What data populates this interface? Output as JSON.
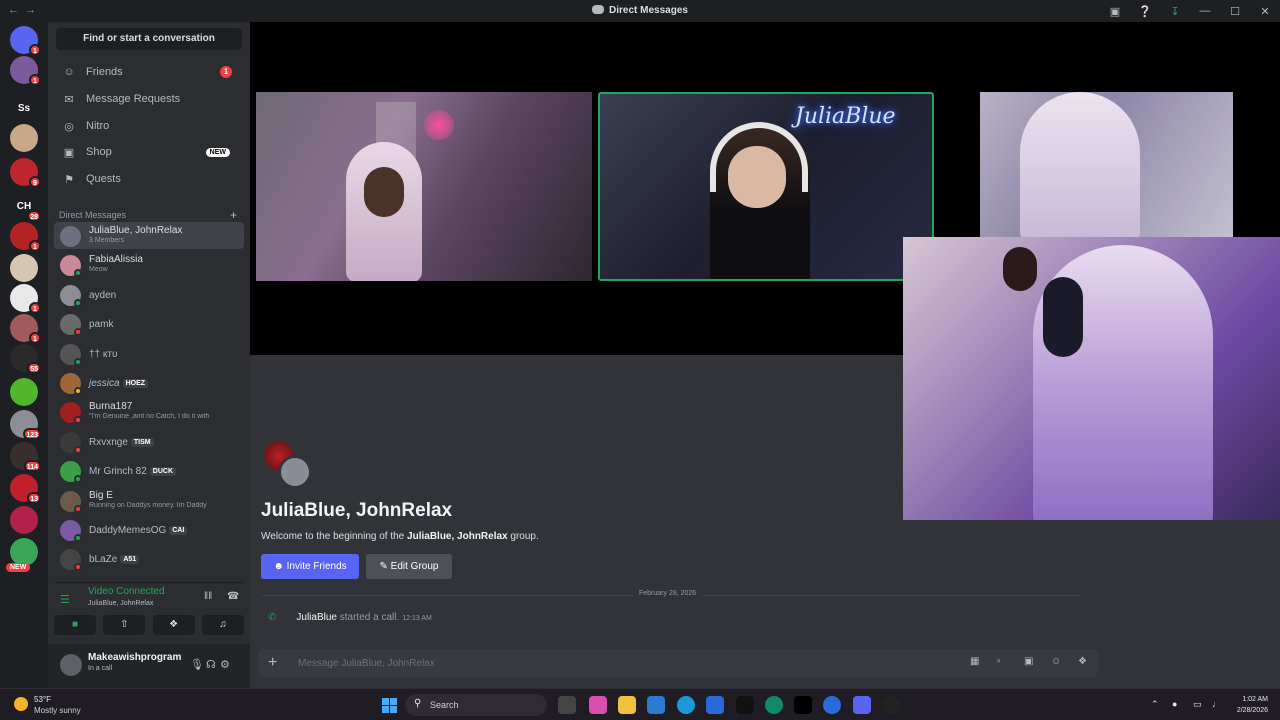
{
  "titlebar": {
    "title": "Direct Messages",
    "back": "←",
    "forward": "→"
  },
  "rail": {
    "servers": [
      {
        "label": "",
        "color": "#5865f2",
        "badge": "1",
        "icon": "discord-logo-icon"
      },
      {
        "label": "",
        "color": "#7a5a9a",
        "badge": "1",
        "icon": "server-avatar-icon"
      },
      {
        "label": "Ss",
        "color": "#1e1f22",
        "badge": "",
        "icon": ""
      },
      {
        "label": "",
        "color": "#c9a88a",
        "badge": "",
        "icon": "server-avatar-icon"
      },
      {
        "label": "",
        "color": "#c0262d",
        "badge": "9",
        "icon": "server-avatar-icon"
      },
      {
        "label": "CH",
        "color": "#1e1f22",
        "badge": "28",
        "icon": ""
      },
      {
        "label": "",
        "color": "#b22323",
        "badge": "1",
        "icon": "server-avatar-icon"
      },
      {
        "label": "",
        "color": "#d4c6b0",
        "badge": "",
        "icon": "server-avatar-icon"
      },
      {
        "label": "",
        "color": "#e8e8e8",
        "badge": "1",
        "icon": "server-avatar-icon"
      },
      {
        "label": "",
        "color": "#a05a5a",
        "badge": "1",
        "icon": "server-avatar-icon"
      },
      {
        "label": "",
        "color": "#2a2a2a",
        "badge": "55",
        "icon": "server-avatar-icon"
      },
      {
        "label": "",
        "color": "#4fb52a",
        "badge": "",
        "icon": "server-avatar-icon"
      },
      {
        "label": "",
        "color": "#8d8d95",
        "badge": "123",
        "icon": "server-avatar-icon"
      },
      {
        "label": "",
        "color": "#3a2f2f",
        "badge": "114",
        "icon": "server-avatar-icon"
      },
      {
        "label": "",
        "color": "#c0202a",
        "badge": "13",
        "icon": "server-avatar-icon"
      },
      {
        "label": "",
        "color": "#b3204a",
        "badge": "",
        "icon": "server-avatar-icon"
      },
      {
        "label": "",
        "color": "#3ba55a",
        "badge": "",
        "icon": "server-avatar-icon",
        "new": "NEW"
      }
    ]
  },
  "sidebar": {
    "find_label": "Find or start a conversation",
    "nav": [
      {
        "label": "Friends",
        "icon": "friends-icon",
        "glyph": "☺",
        "count": "1"
      },
      {
        "label": "Message Requests",
        "icon": "envelope-icon",
        "glyph": "✉",
        "count": ""
      },
      {
        "label": "Nitro",
        "icon": "nitro-icon",
        "glyph": "◎",
        "count": ""
      },
      {
        "label": "Shop",
        "icon": "shop-icon",
        "glyph": "▣",
        "count": "",
        "pill": "NEW"
      },
      {
        "label": "Quests",
        "icon": "quests-icon",
        "glyph": "⚑",
        "count": ""
      }
    ],
    "dm_header": "Direct Messages",
    "dms": [
      {
        "name": "JuliaBlue, JohnRelax",
        "sub": "3 Members",
        "tag": "",
        "status": "",
        "color": "#6e7080",
        "active": true
      },
      {
        "name": "FabiaAlissia",
        "sub": "Meow",
        "tag": "",
        "status": "#23a55a",
        "color": "#c88a9a"
      },
      {
        "name": "ayden",
        "sub": "",
        "tag": "",
        "status": "#23a55a",
        "color": "#8d8d95"
      },
      {
        "name": "pamk",
        "sub": "",
        "tag": "",
        "status": "#f23f43",
        "color": "#6a6a6a"
      },
      {
        "name": "†† ктυ",
        "sub": "",
        "tag": "",
        "status": "#23a55a",
        "color": "#555"
      },
      {
        "name": "jessica",
        "sub": "",
        "tag": "HOEZ",
        "status": "#f0b232",
        "color": "#a0663a",
        "italic": true
      },
      {
        "name": "Burna187",
        "sub": "\"I'm Genuine ,aint no Catch, I do it with",
        "tag": "",
        "status": "#f23f43",
        "color": "#a02020"
      },
      {
        "name": "Rxvxnge",
        "sub": "",
        "tag": "TISM",
        "status": "#f23f43",
        "color": "#3a3a3a"
      },
      {
        "name": "Mr Grinch 82",
        "sub": "",
        "tag": "DUCK",
        "status": "#23a55a",
        "color": "#3aa04a"
      },
      {
        "name": "Big E",
        "sub": "Running on Daddys money. Im Daddy",
        "tag": "",
        "status": "#f23f43",
        "color": "#6e5a4a"
      },
      {
        "name": "DaddyMemesOG",
        "sub": "",
        "tag": "CAI",
        "status": "#23a55a",
        "color": "#7a5aa0"
      },
      {
        "name": "bLaZe",
        "sub": "",
        "tag": "A51",
        "status": "#f23f43",
        "color": "#444"
      }
    ],
    "voice": {
      "status": "Video Connected",
      "channel": "JuliaBlue, JohnRelax"
    },
    "user": {
      "name": "Makeawishprogram",
      "status": "In a call"
    }
  },
  "call": {
    "neon_text": "JuliaBlue"
  },
  "chat": {
    "group_title": "JuliaBlue, JohnRelax",
    "welcome_prefix": "Welcome to the beginning of the ",
    "welcome_group": "JuliaBlue, JohnRelax",
    "welcome_suffix": " group.",
    "invite_label": "Invite Friends",
    "edit_label": "Edit Group",
    "date_divider": "February 28, 2026",
    "message_user": "JuliaBlue",
    "message_text": " started a call.",
    "message_time": "12:13 AM",
    "composer_placeholder": "Message JuliaBlue, JohnRelax"
  },
  "taskbar": {
    "temp": "53°F",
    "weather": "Mostly sunny",
    "search": "Search",
    "time": "1:02 AM",
    "date": "2/28/2026"
  }
}
